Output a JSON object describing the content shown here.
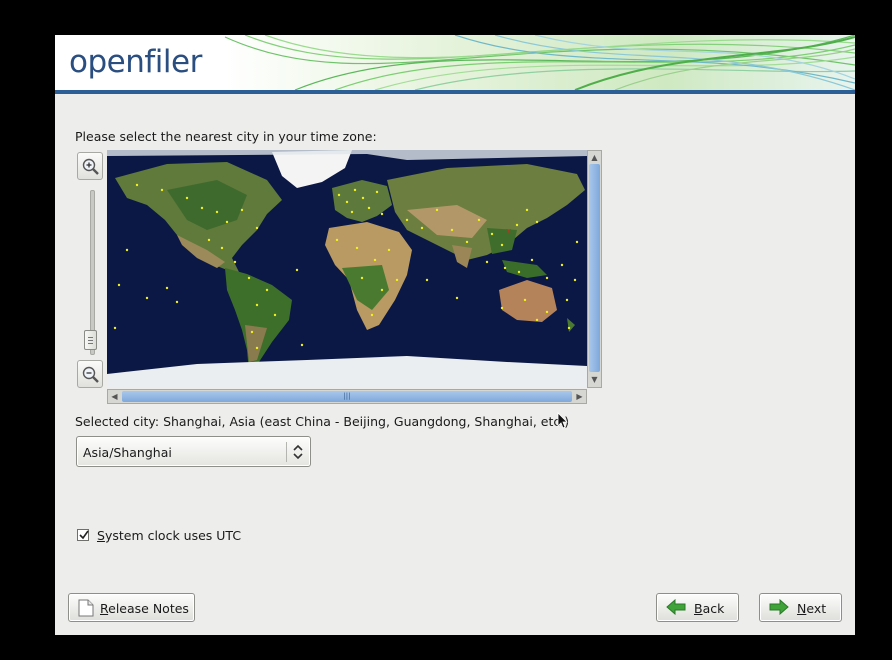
{
  "window": {
    "brand": "openfiler"
  },
  "timezone": {
    "prompt": "Please select the nearest city in your time zone:",
    "zoom_in_icon": "zoom-in-icon",
    "zoom_out_icon": "zoom-out-icon",
    "zoom_level": 0,
    "selected_city_text": "Selected city: Shanghai, Asia (east China - Beijing, Guangdong, Shanghai, etc.)",
    "selected_marker_color": "#e02020",
    "city_dot_color": "#f0f020",
    "combo_value": "Asia/Shanghai"
  },
  "utc": {
    "checked": true,
    "label_first": "S",
    "label_rest": "ystem clock uses UTC"
  },
  "buttons": {
    "release_notes": {
      "mnemonic": "R",
      "rest": "elease Notes"
    },
    "back": {
      "mnemonic": "B",
      "rest": "ack"
    },
    "next": {
      "mnemonic": "N",
      "rest": "ext"
    }
  },
  "colors": {
    "banner_rule": "#2b5f95",
    "arrow_green": "#3fa33a",
    "scroll_thumb": "#8fb4e0"
  }
}
